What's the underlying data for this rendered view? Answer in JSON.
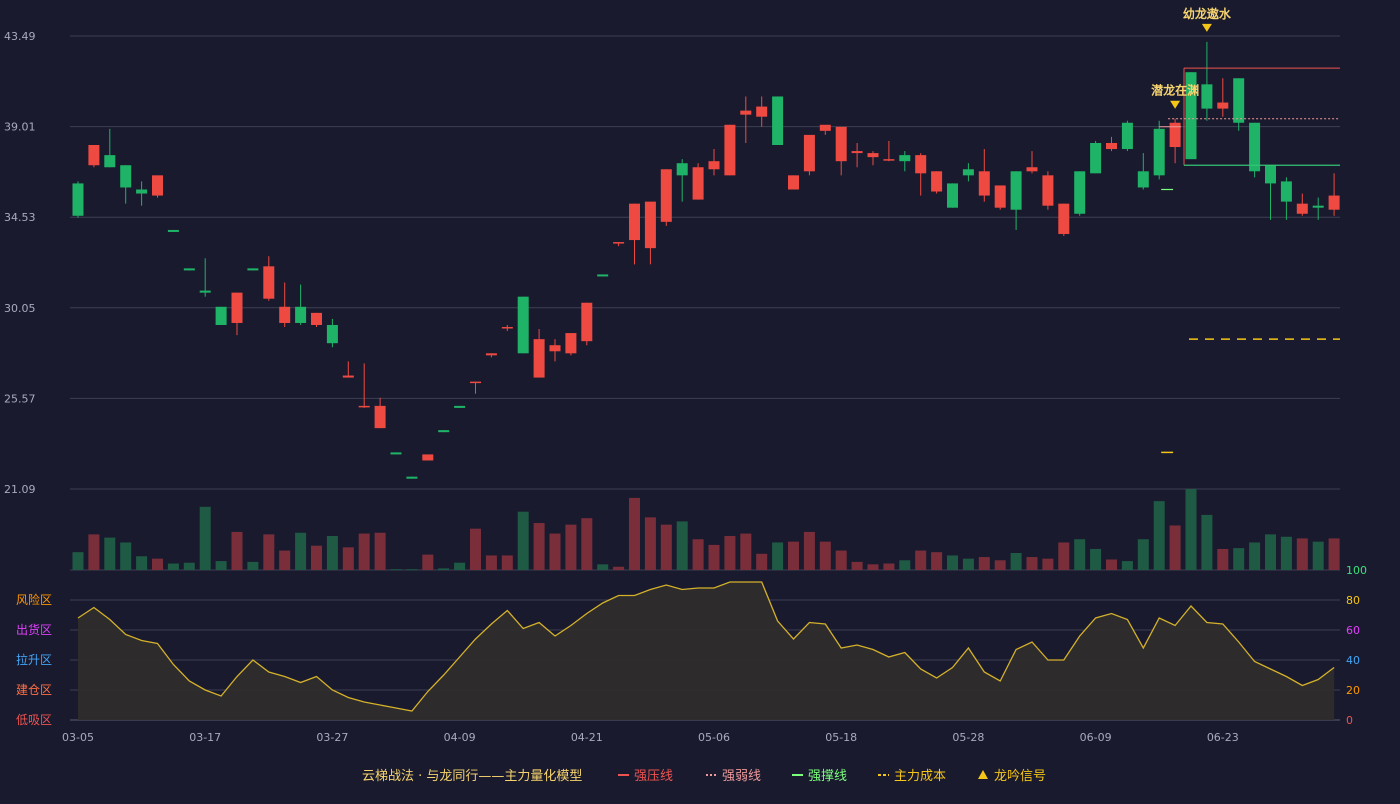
{
  "chart_data": {
    "type": "candlestick",
    "price_axis": {
      "ticks": [
        "43.49",
        "39.01",
        "34.53",
        "30.05",
        "25.57",
        "21.09"
      ],
      "range": [
        21.09,
        43.49
      ]
    },
    "x_axis": {
      "labels": [
        {
          "text": "03-05",
          "index": 0
        },
        {
          "text": "03-17",
          "index": 8
        },
        {
          "text": "03-27",
          "index": 16
        },
        {
          "text": "04-09",
          "index": 24
        },
        {
          "text": "04-21",
          "index": 32
        },
        {
          "text": "05-06",
          "index": 40
        },
        {
          "text": "05-18",
          "index": 48
        },
        {
          "text": "05-28",
          "index": 56
        },
        {
          "text": "06-09",
          "index": 64
        },
        {
          "text": "06-23",
          "index": 72
        }
      ]
    },
    "ohlc": [
      [
        36.2,
        36.3,
        34.5,
        34.6
      ],
      [
        37.1,
        38.1,
        37.0,
        38.1
      ],
      [
        37.6,
        38.9,
        37.0,
        37.0
      ],
      [
        37.1,
        37.1,
        35.2,
        36.0
      ],
      [
        35.9,
        36.3,
        35.1,
        35.7
      ],
      [
        35.6,
        36.6,
        35.5,
        36.6
      ],
      [
        33.9,
        33.9,
        33.8,
        33.8
      ],
      [
        32.0,
        32.0,
        31.9,
        31.9
      ],
      [
        30.9,
        32.5,
        30.6,
        30.8
      ],
      [
        30.1,
        30.1,
        29.2,
        29.2
      ],
      [
        29.3,
        30.8,
        28.7,
        30.8
      ],
      [
        32.0,
        32.0,
        31.9,
        31.9
      ],
      [
        30.5,
        32.6,
        30.4,
        32.1
      ],
      [
        29.3,
        31.3,
        29.1,
        30.1
      ],
      [
        30.1,
        31.2,
        29.2,
        29.3
      ],
      [
        29.2,
        29.8,
        29.1,
        29.8
      ],
      [
        29.2,
        29.5,
        28.1,
        28.3
      ],
      [
        26.6,
        27.4,
        26.6,
        26.7
      ],
      [
        25.2,
        27.3,
        25.1,
        25.2
      ],
      [
        24.1,
        25.6,
        24.1,
        25.2
      ],
      [
        22.9,
        22.9,
        22.8,
        22.8
      ],
      [
        21.7,
        21.7,
        21.6,
        21.6
      ],
      [
        22.5,
        22.8,
        22.5,
        22.8
      ],
      [
        24.0,
        24.0,
        23.9,
        23.9
      ],
      [
        25.2,
        25.2,
        25.1,
        25.1
      ],
      [
        26.4,
        26.4,
        25.8,
        26.4
      ],
      [
        27.7,
        27.8,
        27.6,
        27.8
      ],
      [
        29.1,
        29.2,
        28.9,
        29.1
      ],
      [
        30.6,
        30.6,
        27.8,
        27.8
      ],
      [
        26.6,
        29.0,
        26.6,
        28.5
      ],
      [
        27.9,
        28.5,
        27.4,
        28.2
      ],
      [
        27.8,
        28.8,
        27.7,
        28.8
      ],
      [
        28.4,
        30.3,
        28.2,
        30.3
      ],
      [
        31.7,
        31.7,
        31.6,
        31.6
      ],
      [
        33.3,
        33.3,
        33.1,
        33.3
      ],
      [
        33.4,
        35.2,
        32.2,
        35.2
      ],
      [
        33.0,
        35.2,
        32.2,
        35.3
      ],
      [
        34.3,
        36.9,
        34.1,
        36.9
      ],
      [
        37.2,
        37.4,
        35.3,
        36.6
      ],
      [
        35.4,
        37.2,
        35.4,
        37.0
      ],
      [
        36.9,
        37.9,
        36.6,
        37.3
      ],
      [
        36.6,
        39.1,
        36.6,
        39.1
      ],
      [
        39.6,
        40.5,
        38.2,
        39.8
      ],
      [
        39.5,
        40.5,
        39.0,
        40.0
      ],
      [
        40.5,
        40.5,
        38.1,
        38.1
      ],
      [
        35.9,
        36.6,
        35.9,
        36.6
      ],
      [
        36.8,
        38.1,
        36.6,
        38.6
      ],
      [
        38.8,
        38.8,
        38.6,
        39.1
      ],
      [
        37.3,
        38.7,
        36.6,
        39.0
      ],
      [
        37.7,
        38.2,
        37.0,
        37.8
      ],
      [
        37.5,
        37.8,
        37.1,
        37.7
      ],
      [
        37.4,
        38.3,
        37.3,
        37.4
      ],
      [
        37.6,
        37.8,
        36.8,
        37.3
      ],
      [
        36.7,
        37.7,
        35.6,
        37.6
      ],
      [
        35.8,
        36.8,
        35.7,
        36.8
      ],
      [
        36.2,
        36.2,
        35.0,
        35.0
      ],
      [
        36.9,
        37.2,
        36.3,
        36.6
      ],
      [
        35.6,
        37.9,
        35.3,
        36.8
      ],
      [
        35.0,
        36.1,
        34.9,
        36.1
      ],
      [
        36.8,
        36.8,
        33.9,
        34.9
      ],
      [
        36.8,
        37.8,
        36.7,
        37.0
      ],
      [
        35.1,
        36.8,
        34.9,
        36.6
      ],
      [
        33.7,
        35.2,
        33.6,
        35.2
      ],
      [
        36.8,
        36.8,
        34.6,
        34.7
      ],
      [
        38.2,
        38.3,
        36.7,
        36.7
      ],
      [
        37.9,
        38.5,
        37.8,
        38.2
      ],
      [
        39.2,
        39.3,
        37.8,
        37.9
      ],
      [
        36.8,
        37.7,
        35.9,
        36.0
      ],
      [
        38.9,
        39.3,
        36.4,
        36.6
      ],
      [
        38.0,
        39.4,
        37.2,
        39.2
      ],
      [
        41.7,
        41.7,
        37.5,
        37.4
      ],
      [
        41.1,
        43.2,
        39.3,
        39.9
      ],
      [
        39.9,
        41.4,
        39.5,
        40.2
      ],
      [
        41.4,
        41.4,
        38.8,
        39.2
      ],
      [
        39.2,
        39.2,
        36.5,
        36.8
      ],
      [
        37.1,
        37.1,
        34.4,
        36.2
      ],
      [
        36.3,
        36.5,
        34.4,
        35.3
      ],
      [
        34.7,
        35.7,
        34.6,
        35.2
      ],
      [
        35.1,
        35.5,
        34.4,
        35.0
      ],
      [
        34.9,
        36.7,
        34.6,
        35.6
      ]
    ],
    "volume": [
      0.22,
      0.44,
      0.4,
      0.34,
      0.17,
      0.14,
      0.08,
      0.09,
      0.78,
      0.11,
      0.47,
      0.1,
      0.44,
      0.24,
      0.46,
      0.3,
      0.42,
      0.28,
      0.45,
      0.46,
      0.01,
      0.01,
      0.19,
      0.02,
      0.09,
      0.51,
      0.18,
      0.18,
      0.72,
      0.58,
      0.45,
      0.56,
      0.64,
      0.07,
      0.04,
      0.89,
      0.65,
      0.56,
      0.6,
      0.38,
      0.31,
      0.42,
      0.45,
      0.2,
      0.34,
      0.35,
      0.47,
      0.35,
      0.24,
      0.1,
      0.07,
      0.08,
      0.12,
      0.24,
      0.22,
      0.18,
      0.14,
      0.16,
      0.12,
      0.21,
      0.16,
      0.14,
      0.34,
      0.38,
      0.26,
      0.13,
      0.11,
      0.38,
      0.85,
      0.55,
      1.0,
      0.68,
      0.26,
      0.27,
      0.34,
      0.44,
      0.41,
      0.39,
      0.35,
      0.39
    ],
    "oscillator": {
      "axis_ticks": [
        "100",
        "80",
        "60",
        "40",
        "20",
        "0"
      ],
      "zones": [
        "风险区",
        "出货区",
        "拉升区",
        "建仓区",
        "低吸区"
      ],
      "values": [
        68,
        75,
        67,
        57,
        53,
        51,
        37,
        26,
        20,
        16,
        29,
        40,
        32,
        29,
        25,
        29,
        20,
        15,
        12,
        10,
        8,
        6,
        19,
        30,
        42,
        54,
        64,
        73,
        61,
        65,
        56,
        63,
        71,
        78,
        83,
        83,
        87,
        90,
        87,
        88,
        88,
        92,
        92,
        92,
        66,
        54,
        65,
        64,
        48,
        50,
        47,
        42,
        45,
        34,
        28,
        35,
        48,
        32,
        26,
        47,
        52,
        40,
        40,
        56,
        68,
        71,
        67,
        48,
        68,
        63,
        76,
        65,
        64,
        52,
        39,
        34,
        29,
        23,
        27,
        35
      ]
    },
    "levels": {
      "strong_pressure": 41.9,
      "weak_pressure": 39.4,
      "strong_support": 37.1,
      "support_marker": 35.9,
      "main_cost": 28.5,
      "cost_marker": 22.9
    },
    "annotations": [
      {
        "text": "潜龙在渊",
        "index": 69
      },
      {
        "text": "幼龙遨水",
        "index": 71
      }
    ],
    "legend": {
      "title": "云梯战法 · 与龙同行——主力量化模型",
      "items": [
        {
          "label": "强压线",
          "color": "#ef5350",
          "style": "solid"
        },
        {
          "label": "强弱线",
          "color": "#ef9a9a",
          "style": "dotted"
        },
        {
          "label": "强撑线",
          "color": "#7cff7c",
          "style": "solid"
        },
        {
          "label": "主力成本",
          "color": "#f5c518",
          "style": "dashed"
        },
        {
          "label": "龙吟信号",
          "color": "#f5c518",
          "style": "triangle"
        }
      ]
    },
    "colors": {
      "up": "#ef4a41",
      "down": "#1fb367",
      "grid": "#3d3f52",
      "osc_line": "#d4b12a"
    }
  }
}
